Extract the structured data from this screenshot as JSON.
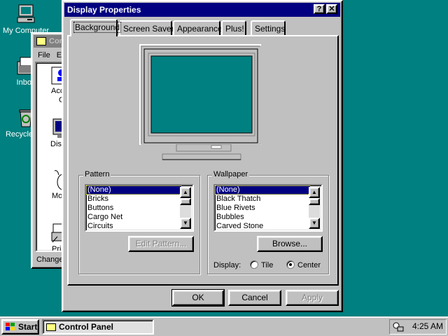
{
  "desktop": {
    "icons": [
      {
        "label": "My Computer",
        "icon": "my-computer-icon"
      },
      {
        "label": "Inbox",
        "icon": "inbox-icon"
      },
      {
        "label": "Recycle Bin",
        "icon": "recycle-bin-icon"
      }
    ]
  },
  "control_panel_window": {
    "title": "Control Panel",
    "menu": [
      "File",
      "Edit"
    ],
    "items": [
      {
        "label": "Accessibility Options",
        "icon": "accessibility-icon"
      },
      {
        "label": "Display",
        "icon": "display-icon"
      },
      {
        "label": "Mouse",
        "icon": "mouse-icon"
      },
      {
        "label": "Printers",
        "icon": "printers-icon"
      }
    ],
    "status": "Changes the appearance of your display"
  },
  "dialog": {
    "title": "Display Properties",
    "help_button": "?",
    "close_button": "✕",
    "tabs": [
      {
        "label": "Background",
        "active": true
      },
      {
        "label": "Screen Saver",
        "active": false
      },
      {
        "label": "Appearance",
        "active": false
      },
      {
        "label": "Plus!",
        "active": false
      },
      {
        "label": "Settings",
        "active": false
      }
    ],
    "preview_color": "#008080",
    "pattern": {
      "label": "Pattern",
      "items": [
        "(None)",
        "Bricks",
        "Buttons",
        "Cargo Net",
        "Circuits"
      ],
      "selected": "(None)",
      "edit_button": "Edit Pattern..."
    },
    "wallpaper": {
      "label": "Wallpaper",
      "items": [
        "(None)",
        "Black Thatch",
        "Blue Rivets",
        "Bubbles",
        "Carved Stone"
      ],
      "selected": "(None)",
      "browse_button": "Browse...",
      "display_label": "Display:",
      "options": [
        {
          "label": "Tile",
          "checked": false
        },
        {
          "label": "Center",
          "checked": true
        }
      ]
    },
    "buttons": {
      "ok": "OK",
      "cancel": "Cancel",
      "apply": "Apply"
    }
  },
  "taskbar": {
    "start_label": "Start",
    "tasks": [
      {
        "label": "Control Panel"
      }
    ],
    "clock": "4:25 AM"
  },
  "colors": {
    "desktop": "#008080",
    "titlebar_active": "#000080",
    "face": "#c0c0c0"
  }
}
